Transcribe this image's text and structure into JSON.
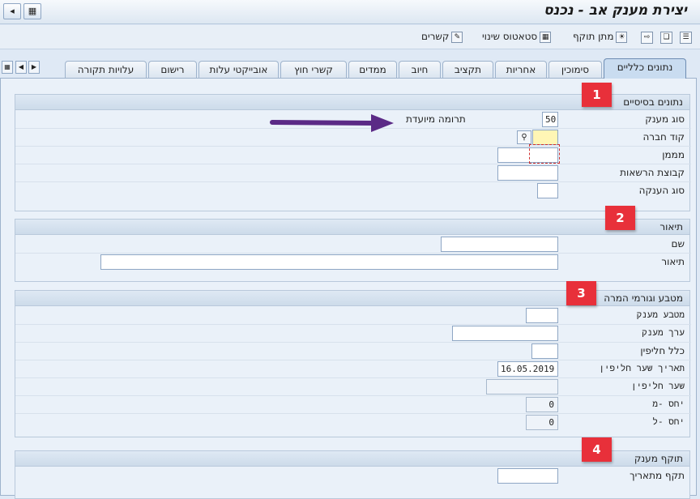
{
  "window": {
    "title": "יצירת מענק אב - נכנס"
  },
  "toolbar": {
    "items": [
      "קשרים",
      "סטאטוס שינוי",
      "מתן תוקף"
    ]
  },
  "tabs": [
    "נתונים כלליים",
    "סימוכין",
    "אחריות",
    "תקציב",
    "חיוב",
    "ממדים",
    "קשרי חוץ",
    "אובייקטי עלות",
    "רישום",
    "עלויות תקורה"
  ],
  "sections": {
    "basic": {
      "title": "נתונים בסיסיים",
      "badge": "1",
      "fields": {
        "grant_type": {
          "label": "סוג מענק",
          "value": "50",
          "description": "תרומה מיועדת"
        },
        "company_code": {
          "label": "קוד חברה",
          "value": ""
        },
        "sponsor": {
          "label": "מממן",
          "value": ""
        },
        "auth_group": {
          "label": "קבוצת הרשאות",
          "value": ""
        },
        "award_type": {
          "label": "סוג הענקה",
          "value": ""
        }
      }
    },
    "description": {
      "title": "תיאור",
      "badge": "2",
      "fields": {
        "name": {
          "label": "שם",
          "value": ""
        },
        "desc": {
          "label": "תיאור",
          "value": ""
        }
      }
    },
    "currency": {
      "title": "מטבע וגורמי המרה",
      "badge": "3",
      "fields": {
        "grant_currency": {
          "label": "מטבע מענק",
          "value": ""
        },
        "grant_value": {
          "label": "ערך מענק",
          "value": ""
        },
        "exch_rule": {
          "label": "כלל חליפין",
          "value": ""
        },
        "exch_date": {
          "label": "תאריך שער חליפין",
          "value": "16.05.2019"
        },
        "exch_rate": {
          "label": "שער חליפין",
          "value": ""
        },
        "ratio_from": {
          "label": "יחס -מ",
          "value": "0"
        },
        "ratio_to": {
          "label": "יחס -ל",
          "value": "0"
        }
      }
    },
    "validity": {
      "title": "תוקף מענק",
      "badge": "4",
      "fields": {
        "valid_from": {
          "label": "תקף מתאריך",
          "value": ""
        }
      }
    }
  },
  "colors": {
    "badge": "#e8303a",
    "arrow": "#5b2a86",
    "required": "#fff6b5"
  }
}
